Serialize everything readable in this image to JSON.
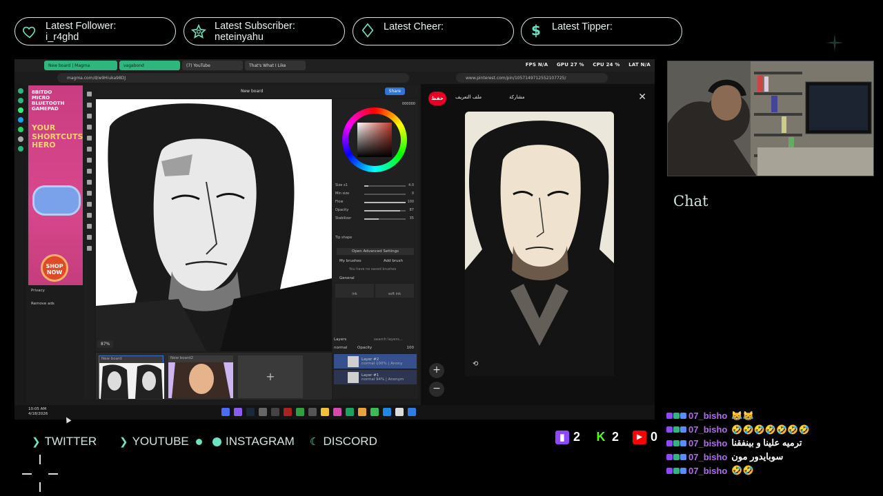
{
  "stats": {
    "follower": {
      "label": "Latest Follower:",
      "value": "i_r4ghd"
    },
    "subscriber": {
      "label": "Latest Subscriber:",
      "value": "neteinyahu"
    },
    "cheer": {
      "label": "Latest Cheer:",
      "value": ""
    },
    "tipper": {
      "label": "Latest Tipper:",
      "value": ""
    }
  },
  "browser": {
    "tabs": [
      "New board | Magma",
      "vagabond",
      "(7) YouTube",
      "That's What I Like"
    ],
    "perf": {
      "fps": "FPS N/A",
      "gpu": "GPU 27 %",
      "cpu": "CPU 24 %",
      "lat": "LAT N/A"
    },
    "url_left": "magma.com/d/w9Hiuka98DJ",
    "url_right": "www.pinterest.com/pin/1057149712552107725/"
  },
  "ad": {
    "line1": "8BITDO MICRO BLUETOOTH GAMEPAD",
    "line2": "YOUR SHORTCUTS HERO",
    "cta": "SHOP NOW",
    "privacy": "Privacy",
    "remove_ads": "Remove ads"
  },
  "app": {
    "board_title": "New board",
    "share": "Share",
    "zoom": "87%",
    "hex": "000000",
    "sliders": [
      {
        "label": "Size x1",
        "value": "4.0",
        "level": 0.1
      },
      {
        "label": "Min size",
        "value": "0",
        "level": 0.0
      },
      {
        "label": "Flow",
        "value": "100",
        "level": 1.0
      },
      {
        "label": "Opacity",
        "value": "87",
        "level": 0.87
      },
      {
        "label": "Stabilizer",
        "value": "35",
        "level": 0.35
      }
    ],
    "tip_shape": "Tip shape",
    "advanced": "Open Advanced Settings",
    "my_brushes": "My brushes",
    "add_brush": "Add brush",
    "no_brushes": "You have no saved brushes",
    "general": "General",
    "brush_names": [
      "ink",
      "soft ink"
    ],
    "layers_title": "Layers",
    "layer_search": "search layers...",
    "blend": "normal",
    "opacity_label": "Opacity",
    "opacity_val": "100",
    "layers": [
      {
        "name": "Layer #2",
        "meta": "normal  100%  |  Anony",
        "selected": true
      },
      {
        "name": "Layer #1",
        "meta": "normal  94%  |  Anonym",
        "selected": false
      }
    ],
    "boards": [
      "New board",
      "New board2"
    ]
  },
  "taskbar": {
    "time": "10:05 AM",
    "date": "4/18/2026"
  },
  "pinterest": {
    "save": "حفظ",
    "profile": "ملف التعريف",
    "share": "مشاركة"
  },
  "chat": {
    "title": "Chat",
    "messages": [
      {
        "user": "07_bisho",
        "text": "😹😹"
      },
      {
        "user": "07_bisho",
        "text": "🤣🤣🤣🤣🤣🤣🤣"
      },
      {
        "user": "07_bisho",
        "text": "ترميه علينا و بينفقنا"
      },
      {
        "user": "07_bisho",
        "text": "سوبايدور مون"
      },
      {
        "user": "07_bisho",
        "text": "🤣🤣"
      }
    ]
  },
  "social": {
    "twitter": "TWITTER",
    "youtube": "YOUTUBE",
    "instagram": "INSTAGRAM",
    "discord": "DISCORD"
  },
  "counts": {
    "twitch": "2",
    "kick": "2",
    "youtube": "0"
  },
  "colors": {
    "accent": "#6be3c3",
    "chat_user": "#b26cf0",
    "pill_border": "#d8ebe0",
    "twitch": "#9146ff",
    "kick": "#53fc18",
    "youtube": "#ff0000"
  }
}
